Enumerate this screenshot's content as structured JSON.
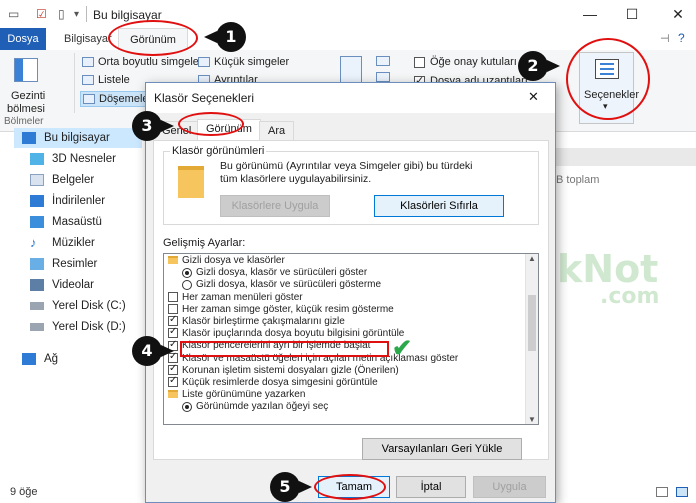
{
  "window": {
    "title": "Bu bilgisayar",
    "controls": [
      "—",
      "☐",
      "✕"
    ]
  },
  "ribbon_tabs": {
    "file": "Dosya",
    "computer": "Bilgisayar",
    "view": "Görünüm"
  },
  "ribbon": {
    "nav_pane_label_1": "Gezinti",
    "nav_pane_label_2": "bölmesi",
    "group_label": "Bölmeler",
    "layout_1": "Orta boyutlu simgeler",
    "layout_2": "Küçük simgeler",
    "layout_3": "Listele",
    "layout_4": "Ayrıntılar",
    "layout_5": "Döşemeler",
    "check_item_boxes": "Öğe onay kutuları",
    "check_file_ext": "Dosya adı uzantıları",
    "options": "Seçenekler",
    "options_caret": "▾"
  },
  "nav": {
    "items": [
      {
        "label": "Bu bilgisayar",
        "icon": "computer-icon"
      },
      {
        "label": "3D Nesneler",
        "icon": "cube-icon"
      },
      {
        "label": "Belgeler",
        "icon": "document-icon"
      },
      {
        "label": "İndirilenler",
        "icon": "download-icon"
      },
      {
        "label": "Masaüstü",
        "icon": "desktop-icon"
      },
      {
        "label": "Müzikler",
        "icon": "music-icon"
      },
      {
        "label": "Resimler",
        "icon": "picture-icon"
      },
      {
        "label": "Videolar",
        "icon": "video-icon"
      },
      {
        "label": "Yerel Disk (C:)",
        "icon": "drive-icon"
      },
      {
        "label": "Yerel Disk (D:)",
        "icon": "drive-icon"
      },
      {
        "label": "Ağ",
        "icon": "network-icon"
      }
    ]
  },
  "content": {
    "partial_text": "B toplam"
  },
  "status": {
    "count": "9 öğe"
  },
  "dialog": {
    "title": "Klasör Seçenekleri",
    "close": "✕",
    "tab_general": "Genel",
    "tab_view": "Görünüm",
    "tab_search": "Ara",
    "folder_views_label": "Klasör görünümleri",
    "folder_views_desc": "Bu görünümü (Ayrıntılar veya Simgeler gibi) bu türdeki tüm klasörlere uygulayabilirsiniz.",
    "apply_to_folders": "Klasörlere Uygula",
    "reset_folders": "Klasörleri Sıfırla",
    "advanced_label": "Gelişmiş Ayarlar:",
    "advanced": [
      {
        "type": "folder",
        "label": "Gizli dosya ve klasörler"
      },
      {
        "type": "radio",
        "on": true,
        "label": "Gizli dosya, klasör ve sürücüleri göster"
      },
      {
        "type": "radio",
        "on": false,
        "label": "Gizli dosya, klasör ve sürücüleri gösterme"
      },
      {
        "type": "check",
        "on": false,
        "label": "Her zaman menüleri göster"
      },
      {
        "type": "check",
        "on": false,
        "label": "Her zaman simge göster, küçük resim gösterme"
      },
      {
        "type": "check",
        "on": true,
        "label": "Klasör birleştirme çakışmalarını gizle"
      },
      {
        "type": "check",
        "on": true,
        "label": "Klasör ipuçlarında dosya boyutu bilgisini görüntüle"
      },
      {
        "type": "check",
        "on": true,
        "label": "Klasör pencerelerini ayrı bir işlemde başlat",
        "highlight": true
      },
      {
        "type": "check",
        "on": true,
        "label": "Klasör ve masaüstü öğeleri için açılan metin açıklaması göster"
      },
      {
        "type": "check",
        "on": true,
        "label": "Korunan işletim sistemi dosyaları gizle (Önerilen)"
      },
      {
        "type": "check",
        "on": true,
        "label": "Küçük resimlerde dosya simgesini görüntüle"
      },
      {
        "type": "folder",
        "label": "Liste görünümüne yazarken"
      },
      {
        "type": "radio",
        "on": true,
        "label": "Görünümde yazılan öğeyi seç"
      }
    ],
    "restore_defaults": "Varsayılanları Geri Yükle",
    "ok": "Tamam",
    "cancel": "İptal",
    "apply": "Uygula"
  },
  "annotations": {
    "n1": "1",
    "n2": "2",
    "n3": "3",
    "n4": "4",
    "n5": "5"
  },
  "watermark": {
    "brand_1": "TeknikNot",
    "brand_2": ".com"
  },
  "colors": {
    "accent": "#1f5fb5",
    "annotation_red": "#e01010",
    "check_green": "#2aa84a"
  }
}
